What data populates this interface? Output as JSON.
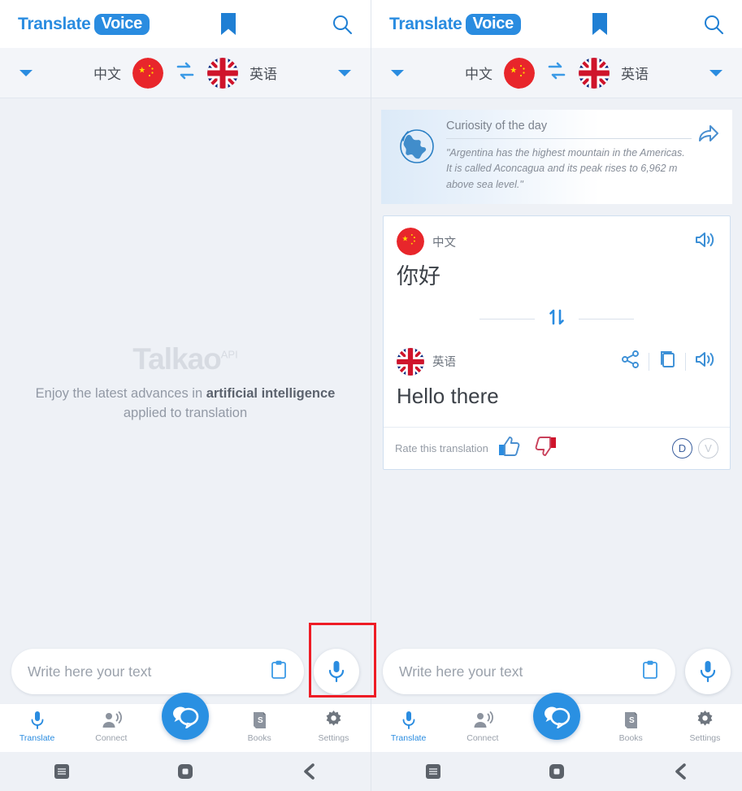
{
  "app": {
    "brand_primary": "Translate",
    "brand_badge": "Voice",
    "accent_color": "#2a8ce0",
    "background_color": "#eef1f6",
    "annotation_color": "#ee1c25"
  },
  "header": {
    "bookmark_icon": "bookmark-icon",
    "search_icon": "search-icon"
  },
  "language_bar": {
    "left_caret": "chevron-down-icon",
    "source_language": "中文",
    "source_flag": "china-flag-icon",
    "swap_icon": "swap-horizontal-icon",
    "target_flag": "uk-flag-icon",
    "target_language": "英语",
    "right_caret": "chevron-down-icon"
  },
  "watermark": {
    "logo": "Talkao",
    "logo_sup": "API",
    "tagline_pre": "Enjoy the latest advances in ",
    "tagline_bold": "artificial intelligence",
    "tagline_post": " applied to translation"
  },
  "curiosity": {
    "globe_icon": "globe-icon",
    "title": "Curiosity of the day",
    "text": "\"Argentina has the highest mountain in the Americas. It is called Aconcagua and its peak rises to 6,962 m above sea level.\"",
    "share_icon": "share-arrow-icon"
  },
  "translation_card": {
    "source": {
      "flag_icon": "china-flag-icon",
      "language": "中文",
      "text": "你好",
      "speaker_icon": "speaker-icon"
    },
    "divider_icon": "swap-vertical-icon",
    "target": {
      "flag_icon": "uk-flag-icon",
      "language": "英语",
      "text": "Hello there",
      "share_icon": "share-nodes-icon",
      "copy_icon": "copy-icon",
      "speaker_icon": "speaker-icon"
    },
    "rate": {
      "label": "Rate this translation",
      "thumb_up_icon": "thumb-up-icon",
      "thumb_down_icon": "thumb-down-icon",
      "badge_dictionary": "D",
      "badge_verified": "V"
    }
  },
  "input_bar": {
    "placeholder": "Write here your text",
    "value": "",
    "clipboard_icon": "clipboard-icon",
    "mic_icon": "microphone-icon"
  },
  "tabbar": {
    "items": [
      {
        "label": "Translate",
        "icon": "microphone-icon",
        "active": true
      },
      {
        "label": "Connect",
        "icon": "person-speaking-icon",
        "active": false
      },
      {
        "label": "",
        "icon": "chat-bubbles-icon",
        "active": false
      },
      {
        "label": "Books",
        "icon": "dictionary-icon",
        "active": false
      },
      {
        "label": "Settings",
        "icon": "gear-icon",
        "active": false
      }
    ]
  },
  "android_nav": {
    "recents_icon": "square-recents-icon",
    "home_icon": "home-icon",
    "back_icon": "back-chevron-icon"
  }
}
